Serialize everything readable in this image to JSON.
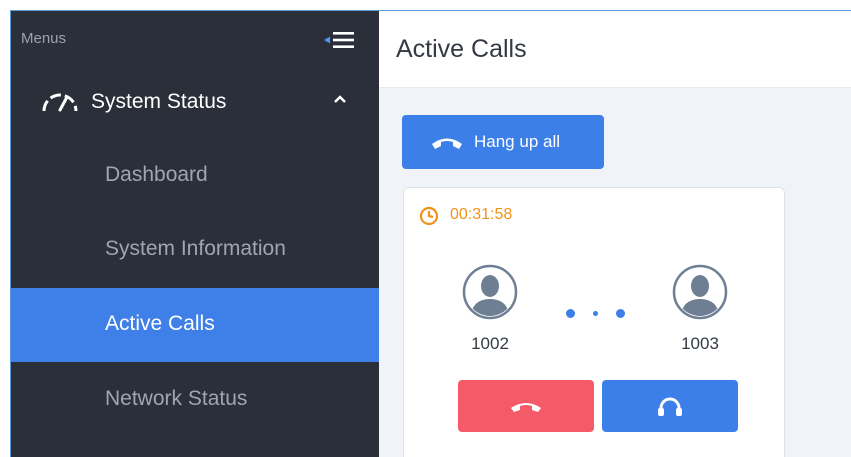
{
  "sidebar": {
    "header_label": "Menus",
    "section": {
      "label": "System Status"
    },
    "items": [
      {
        "label": "Dashboard",
        "active": false
      },
      {
        "label": "System Information",
        "active": false
      },
      {
        "label": "Active Calls",
        "active": true
      },
      {
        "label": "Network Status",
        "active": false
      }
    ]
  },
  "main": {
    "title": "Active Calls",
    "hang_up_all_label": "Hang up all",
    "call": {
      "duration": "00:31:58",
      "caller": "1002",
      "callee": "1003"
    }
  },
  "colors": {
    "sidebar_bg": "#2a2f3a",
    "active_item": "#3e7fe8",
    "primary": "#3d7fe9",
    "danger": "#f55a68",
    "timer": "#f0921c"
  },
  "icons": {
    "collapse": "menu-collapse-icon",
    "section": "gauge-icon",
    "expand": "chevron-up-icon",
    "hang_up_all": "phone-hangup-icon",
    "timer": "clock-icon",
    "participant": "user-avatar-icon",
    "hang_up": "phone-hangup-icon",
    "monitor": "headset-icon"
  }
}
